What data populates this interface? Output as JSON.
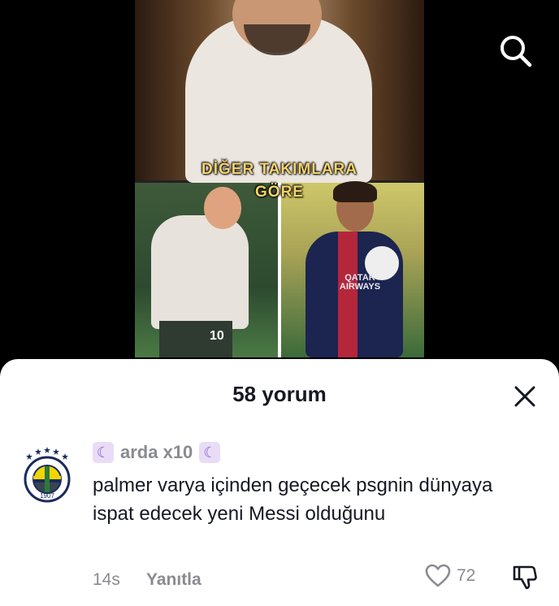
{
  "video": {
    "caption_line1": "DİĞER TAKIMLARA",
    "caption_line2": "GÖRE",
    "search_icon": "search-icon",
    "right_shirt_text": "QATAR AIRWAYS",
    "left_shirt_number": "10"
  },
  "comments_sheet": {
    "title": "58 yorum",
    "close_icon": "close-icon"
  },
  "comment": {
    "username": "arda x10",
    "badge_icon": "moon-icon",
    "avatar": "fenerbahce-crest",
    "avatar_text": "1907",
    "text": "palmer varya içinden geçecek psgnin dünyaya ispat edecek yeni Messi olduğunu",
    "time": "14s",
    "reply_label": "Yanıtla",
    "like_count": "72",
    "like_icon": "heart-icon",
    "dislike_icon": "thumbs-down-icon"
  },
  "colors": {
    "caption": "#f6d36b",
    "muted_text": "#8a8b91",
    "primary_text": "#161823",
    "badge_bg": "#e8dcf7"
  }
}
